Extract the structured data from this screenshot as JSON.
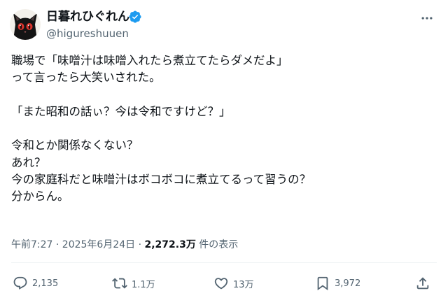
{
  "user": {
    "display_name": "日暮れひぐれん",
    "handle": "@higureshuuen",
    "verified_icon": "verified-badge-icon",
    "avatar_icon": "black-cat-avatar"
  },
  "post": {
    "text": "職場で「味噌汁は味噌入れたら煮立てたらダメだよ」\nって言ったら大笑いされた。\n\n「また昭和の話ぃ？今は令和ですけど？」\n\n令和とか関係なくない？\nあれ？\n今の家庭科だと味噌汁はボコボコに煮立てるって習うの？\n分からん。",
    "timestamp": "午前7:27 · 2025年6月24日",
    "separator": "·",
    "views_count": "2,272.3万",
    "views_label": "件の表示"
  },
  "actions": {
    "reply": {
      "icon": "reply-icon",
      "count": "2,135"
    },
    "repost": {
      "icon": "repost-icon",
      "count": "1.1万"
    },
    "like": {
      "icon": "heart-icon",
      "count": "13万"
    },
    "bookmark": {
      "icon": "bookmark-icon",
      "count": "3,972"
    },
    "share": {
      "icon": "share-icon"
    }
  },
  "colors": {
    "text": "#0f1419",
    "secondary": "#536471",
    "verified": "#1d9bf0",
    "divider": "#eff3f4"
  }
}
